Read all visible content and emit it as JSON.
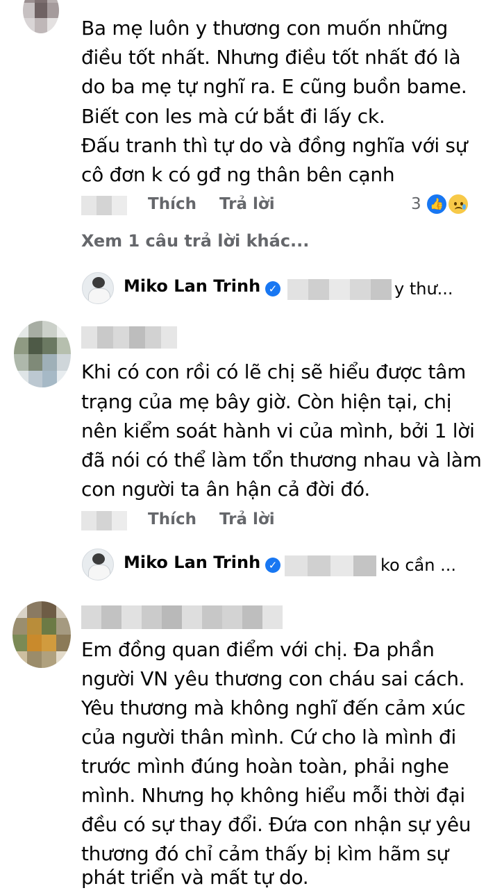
{
  "comments": [
    {
      "lines": [
        "Ba mẹ luôn y thương con muốn những",
        "điều tốt nhất. Nhưng điều tốt nhất đó là",
        "do ba mẹ tự nghĩ ra. E cũng buồn bame.",
        "Biết con les mà cứ bắt đi lấy ck.",
        "Đấu tranh thì tự do và đồng nghĩa với sự",
        "cô đơn k có gđ ng thân bên cạnh"
      ],
      "like_label": "Thích",
      "reply_label": "Trả lời",
      "reaction_count": "3",
      "reactions": [
        "like-icon",
        "sad-icon"
      ],
      "more_replies": "Xem 1 câu trả lời khác...",
      "reply_preview": {
        "name": "Miko Lan Trinh",
        "tail": "y thư..."
      }
    },
    {
      "lines": [
        "Khi có con rồi có lẽ chị sẽ hiểu được tâm",
        "trạng của mẹ bây giờ. Còn hiện tại, chị",
        "nên kiểm soát hành vi của mình, bởi 1 lời",
        "đã nói có thể làm tổn thương nhau và làm",
        "con người ta ân hận cả đời đó."
      ],
      "like_label": "Thích",
      "reply_label": "Trả lời",
      "reply_preview": {
        "name": "Miko Lan Trinh",
        "tail": "ko cần ..."
      }
    },
    {
      "lines": [
        "Em đồng quan điểm với chị. Đa phần",
        "người VN yêu thương con cháu sai cách.",
        "Yêu thương mà không nghĩ đến cảm xúc",
        "của người thân mình. Cứ cho là mình đi",
        "trước mình đúng hoàn toàn, phải nghe",
        "mình. Nhưng họ không hiểu mỗi thời đại",
        "đều có sự thay đổi. Đứa con nhận sự yêu",
        "thương đó chỉ cảm thấy bị kìm hãm sự",
        "phát triển và mất tự do."
      ]
    }
  ],
  "colors": {
    "text": "#050505",
    "secondary": "#65676b",
    "verified": "#1877f2"
  }
}
